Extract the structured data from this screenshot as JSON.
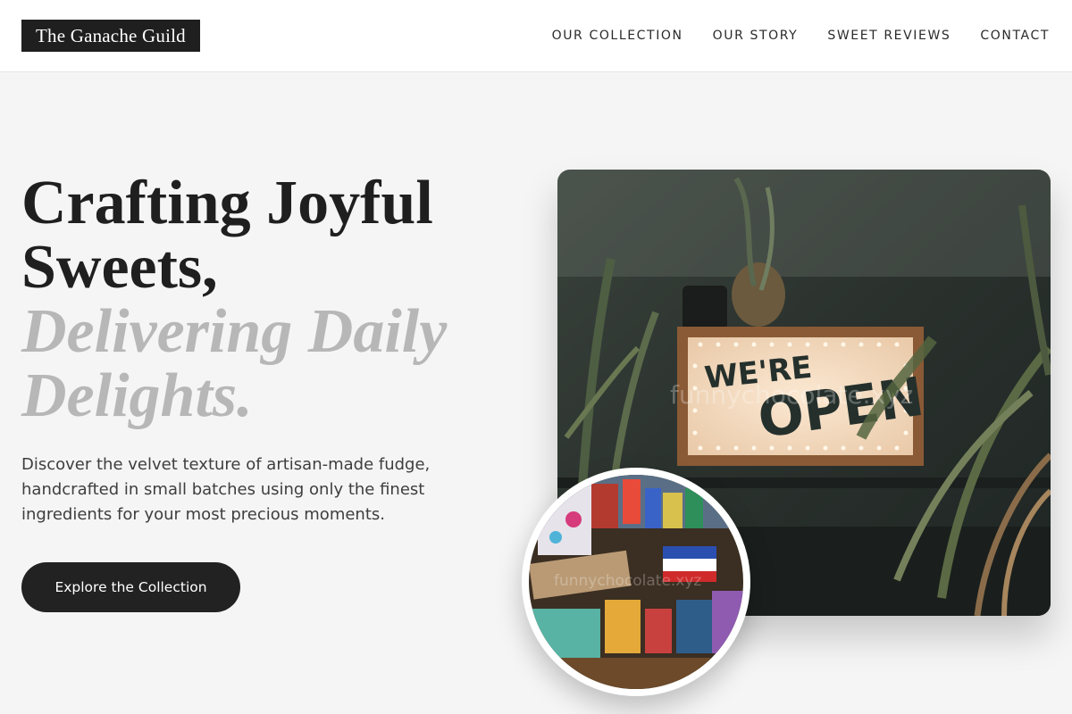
{
  "header": {
    "logo": "The Ganache Guild",
    "nav": [
      "OUR COLLECTION",
      "OUR STORY",
      "SWEET REVIEWS",
      "CONTACT"
    ]
  },
  "hero": {
    "headline_line1": "Crafting Joyful",
    "headline_line2": "Sweets,",
    "headline_line3": "Delivering Daily",
    "headline_line4": "Delights.",
    "description": "Discover the velvet texture of artisan-made fudge, handcrafted in small batches using only the finest ingredients for your most precious moments.",
    "cta_label": "Explore the Collection"
  },
  "images": {
    "main_sign_line1": "WE'RE",
    "main_sign_line2": "OPEN",
    "watermark": "funnychocolate.xyz"
  },
  "colors": {
    "background": "#f5f5f5",
    "dark": "#1f1f1f",
    "muted_text": "#b7b7b7"
  }
}
